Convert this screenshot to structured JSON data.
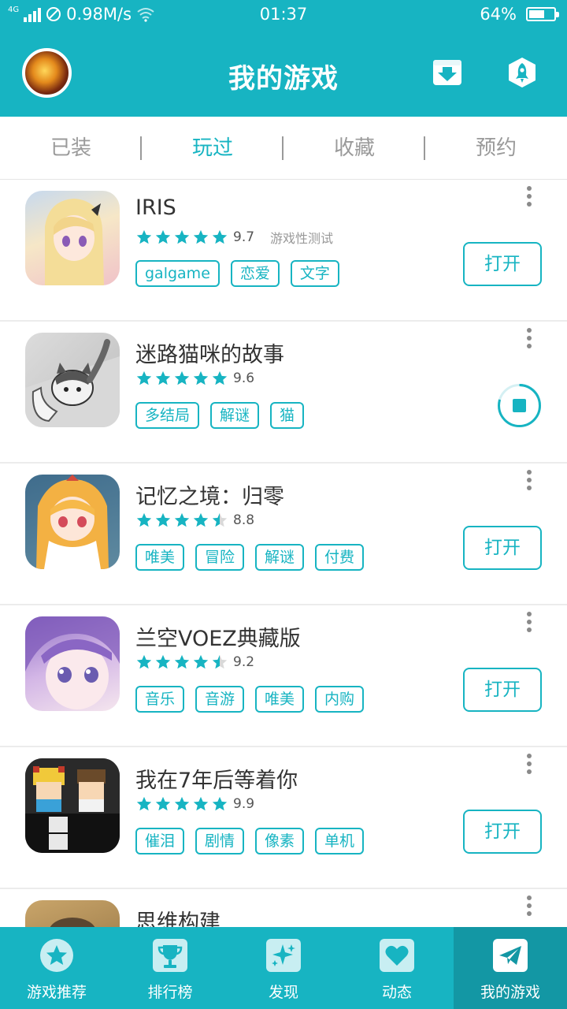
{
  "status_bar": {
    "network": "4G",
    "speed": "0.98M/s",
    "time": "01:37",
    "battery_text": "64%",
    "battery_level": 0.64
  },
  "header": {
    "title": "我的游戏"
  },
  "tabs": [
    {
      "label": "已装",
      "active": false
    },
    {
      "label": "玩过",
      "active": true
    },
    {
      "label": "收藏",
      "active": false
    },
    {
      "label": "预约",
      "active": false
    }
  ],
  "games": [
    {
      "name": "IRIS",
      "rating": 9.7,
      "rating_text": "9.7",
      "stars": 5,
      "note": "游戏性测试",
      "tags": [
        "galgame",
        "恋爱",
        "文字"
      ],
      "action": "打开"
    },
    {
      "name": "迷路猫咪的故事",
      "rating": 9.6,
      "rating_text": "9.6",
      "stars": 5,
      "note": "",
      "tags": [
        "多结局",
        "解谜",
        "猫"
      ],
      "action": "downloading"
    },
    {
      "name": "记忆之境：归零",
      "rating": 8.8,
      "rating_text": "8.8",
      "stars": 4.5,
      "note": "",
      "tags": [
        "唯美",
        "冒险",
        "解谜",
        "付费"
      ],
      "action": "打开"
    },
    {
      "name": "兰空VOEZ典藏版",
      "rating": 9.2,
      "rating_text": "9.2",
      "stars": 4.5,
      "note": "",
      "tags": [
        "音乐",
        "音游",
        "唯美",
        "内购"
      ],
      "action": "打开"
    },
    {
      "name": "我在7年后等着你",
      "rating": 9.9,
      "rating_text": "9.9",
      "stars": 5,
      "note": "",
      "tags": [
        "催泪",
        "剧情",
        "像素",
        "单机"
      ],
      "action": "打开"
    },
    {
      "name": "思维构建",
      "rating": null,
      "rating_text": "",
      "stars": 0,
      "note": "",
      "tags": [],
      "action": ""
    }
  ],
  "bottom_nav": [
    {
      "label": "游戏推荐",
      "icon": "star-icon",
      "active": false
    },
    {
      "label": "排行榜",
      "icon": "trophy-icon",
      "active": false
    },
    {
      "label": "发现",
      "icon": "sparkle-icon",
      "active": false
    },
    {
      "label": "动态",
      "icon": "heart-icon",
      "active": false
    },
    {
      "label": "我的游戏",
      "icon": "paper-plane-icon",
      "active": true
    }
  ],
  "colors": {
    "primary": "#17b4c2",
    "nav_active": "#1397a4",
    "star": "#17b4c2"
  }
}
